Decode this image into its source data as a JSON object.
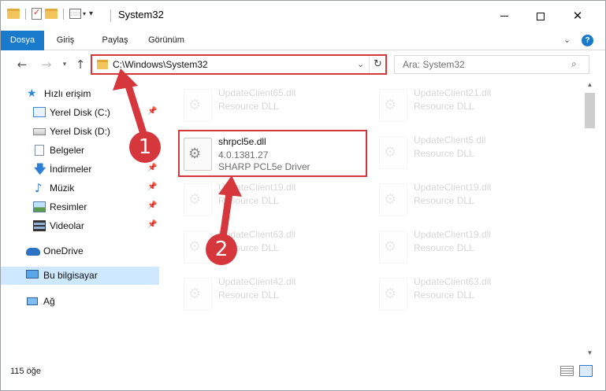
{
  "window": {
    "title": "System32"
  },
  "ribbon": {
    "tabs": [
      "Dosya",
      "Giriş",
      "Paylaş",
      "Görünüm"
    ],
    "accent": "#1979CA"
  },
  "address": {
    "path": "C:\\Windows\\System32"
  },
  "search": {
    "placeholder": "Ara: System32"
  },
  "sidebar": {
    "quick_access": "Hızlı erişim",
    "items": [
      {
        "label": "Yerel Disk (C:)",
        "icon": "drive-icon",
        "pinned": true
      },
      {
        "label": "Yerel Disk (D:)",
        "icon": "drive-icon",
        "pinned": false
      },
      {
        "label": "Belgeler",
        "icon": "documents-icon",
        "pinned": true
      },
      {
        "label": "İndirmeler",
        "icon": "downloads-icon",
        "pinned": true
      },
      {
        "label": "Müzik",
        "icon": "music-icon",
        "pinned": true
      },
      {
        "label": "Resimler",
        "icon": "pictures-icon",
        "pinned": true
      },
      {
        "label": "Videolar",
        "icon": "videos-icon",
        "pinned": true
      }
    ],
    "onedrive": "OneDrive",
    "this_pc": "Bu bilgisayar",
    "network": "Ağ"
  },
  "files": {
    "highlighted": {
      "name": "shrpcl5e.dll",
      "version": "4.0.1381.27",
      "description": "SHARP PCL5e Driver"
    },
    "faded": [
      {
        "name": "UpdateClient65.dll",
        "type": "Resource DLL"
      },
      {
        "name": "UpdateClient21.dll",
        "type": "Resource DLL"
      },
      {
        "name": "UpdateClient5.dll",
        "type": "Resource DLL"
      },
      {
        "name": "UpdateClient19.dll",
        "type": "Resource DLL"
      },
      {
        "name": "UpdateClient19.dll",
        "type": "Resource DLL"
      },
      {
        "name": "UpdateClient63.dll",
        "type": "Resource DLL"
      },
      {
        "name": "UpdateClient19.dll",
        "type": "Resource DLL"
      },
      {
        "name": "UpdateClient42.dll",
        "type": "Resource DLL"
      },
      {
        "name": "UpdateClient63.dll",
        "type": "Resource DLL"
      }
    ]
  },
  "annotations": {
    "step1": "1",
    "step2": "2",
    "color": "#D6373D"
  },
  "status": {
    "count": "115 öğe"
  }
}
